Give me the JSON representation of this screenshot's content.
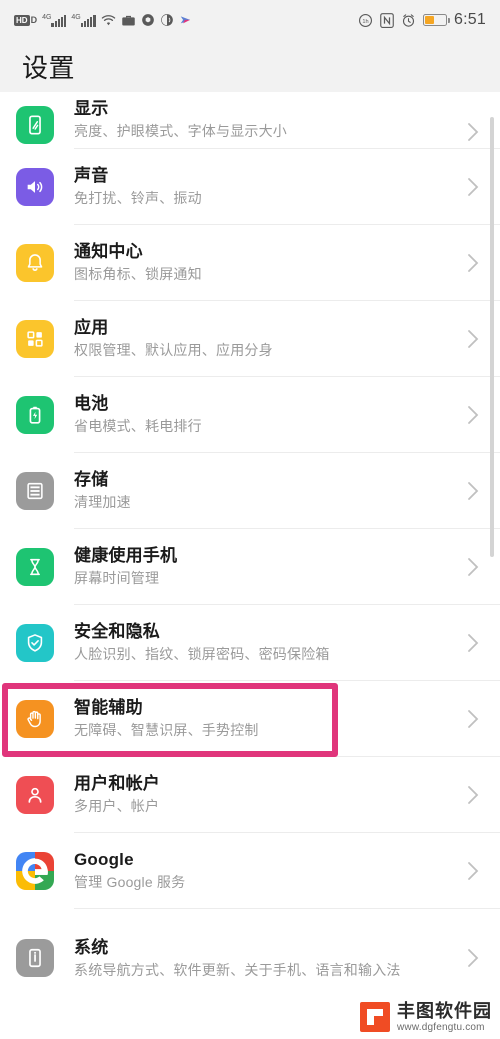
{
  "statusbar": {
    "hd_label": "HD",
    "hd_sub": "D",
    "network_label_1": "4G",
    "network_label_2": "4G",
    "icons": [
      "hd-volte-icon",
      "signal-4g-icon",
      "signal-4g-icon",
      "wifi-icon",
      "work-briefcase-icon",
      "vpn-shield-icon",
      "do-not-disturb-icon",
      "share-icon"
    ],
    "right_icons": [
      "data-saver-icon",
      "nfc-icon",
      "alarm-icon",
      "battery-icon"
    ],
    "time": "6:51"
  },
  "header": {
    "title": "设置"
  },
  "list": {
    "items": [
      {
        "id": "display",
        "title": "显示",
        "subtitle": "亮度、护眼模式、字体与显示大小",
        "icon": "display-icon",
        "color": "#1ec472",
        "cut_top": true
      },
      {
        "id": "sound",
        "title": "声音",
        "subtitle": "免打扰、铃声、振动",
        "icon": "sound-icon",
        "color": "#7b5ce5"
      },
      {
        "id": "notification-center",
        "title": "通知中心",
        "subtitle": "图标角标、锁屏通知",
        "icon": "bell-icon",
        "color": "#fbc52c"
      },
      {
        "id": "apps",
        "title": "应用",
        "subtitle": "权限管理、默认应用、应用分身",
        "icon": "apps-grid-icon",
        "color": "#fbc52c"
      },
      {
        "id": "battery",
        "title": "电池",
        "subtitle": "省电模式、耗电排行",
        "icon": "battery-icon",
        "color": "#1ec472"
      },
      {
        "id": "storage",
        "title": "存储",
        "subtitle": "清理加速",
        "icon": "storage-icon",
        "color": "#9b9b9b"
      },
      {
        "id": "digital-balance",
        "title": "健康使用手机",
        "subtitle": "屏幕时间管理",
        "icon": "hourglass-icon",
        "color": "#1ec472"
      },
      {
        "id": "security-privacy",
        "title": "安全和隐私",
        "subtitle": "人脸识别、指纹、锁屏密码、密码保险箱",
        "icon": "shield-check-icon",
        "color": "#23c6c8"
      },
      {
        "id": "smart-assistance",
        "title": "智能辅助",
        "subtitle": "无障碍、智慧识屏、手势控制",
        "icon": "hand-icon",
        "color": "#f59221",
        "highlighted": true
      },
      {
        "id": "users-accounts",
        "title": "用户和帐户",
        "subtitle": "多用户、帐户",
        "icon": "person-icon",
        "color": "#ef4e54"
      },
      {
        "id": "google",
        "title": "Google",
        "subtitle": "管理 Google 服务",
        "icon": "google-g-icon",
        "color": "#ffffff"
      },
      {
        "id": "system",
        "title": "系统",
        "subtitle": "系统导航方式、软件更新、关于手机、语言和输入法",
        "icon": "system-info-icon",
        "color": "#9b9b9b"
      }
    ],
    "chevron_icon": "chevron-right-icon"
  },
  "highlight": {
    "color": "#e0357b",
    "target": "smart-assistance"
  },
  "watermark": {
    "name": "丰图软件园",
    "url": "www.dgfengtu.com",
    "logo_color": "#f04c24"
  }
}
